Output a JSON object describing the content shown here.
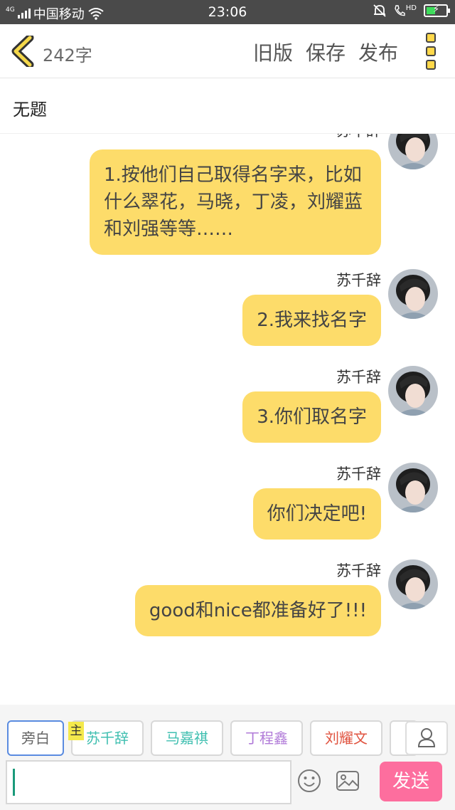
{
  "status_bar": {
    "network": "4G",
    "carrier": "中国移动",
    "time": "23:06",
    "hd_label": "HD",
    "battery_level": 0.45,
    "icons": [
      "signal-icon",
      "wifi-icon",
      "mute-icon",
      "hd-call-icon",
      "battery-icon"
    ]
  },
  "toolbar": {
    "back_icon": "chevron-left-icon",
    "word_count": "242字",
    "old_version_label": "旧版",
    "save_label": "保存",
    "publish_label": "发布",
    "more_icon": "more-vertical-icon"
  },
  "document": {
    "title": "无题"
  },
  "messages": [
    {
      "sender": "苏千辞",
      "text": "1.按他们自己取得名字来，比如什么翠花，马晓，丁凌，刘耀蓝和刘强等等……"
    },
    {
      "sender": "苏千辞",
      "text": "2.我来找名字"
    },
    {
      "sender": "苏千辞",
      "text": "3.你们取名字"
    },
    {
      "sender": "苏千辞",
      "text": "你们决定吧!"
    },
    {
      "sender": "苏千辞",
      "text": "good和nice都准备好了!!!"
    }
  ],
  "characters": {
    "main_tag": "主",
    "items": [
      {
        "name": "旁白",
        "color": "#666666",
        "selected": true
      },
      {
        "name": "苏千辞",
        "color": "#3fbfb0",
        "selected": false
      },
      {
        "name": "马嘉祺",
        "color": "#3fbfb0",
        "selected": false
      },
      {
        "name": "丁程鑫",
        "color": "#b07ad8",
        "selected": false
      },
      {
        "name": "刘耀文",
        "color": "#e0533f",
        "selected": false
      }
    ]
  },
  "composer": {
    "input_value": "",
    "send_label": "发送"
  },
  "colors": {
    "bubble": "#fddc6a",
    "send_button": "#fd6e9e",
    "accent_yellow": "#ffd84a",
    "selected_chip_border": "#5a8be0"
  }
}
